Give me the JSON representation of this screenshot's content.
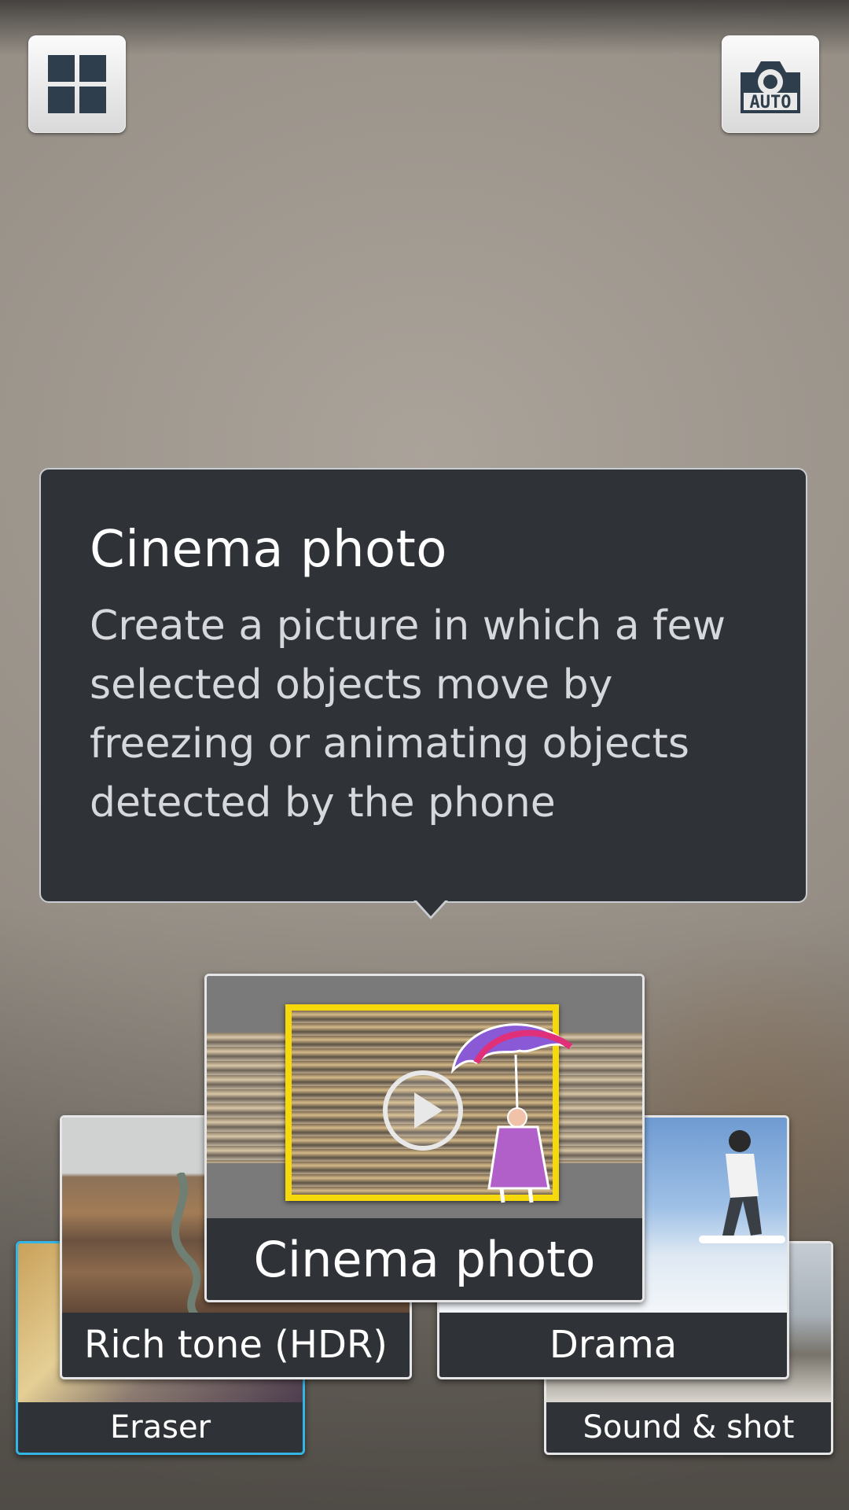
{
  "toolbar": {
    "mode_grid_icon": "grid-icon",
    "auto_mode_icon": "camera-auto-icon",
    "auto_label": "AUTO"
  },
  "tooltip": {
    "title": "Cinema photo",
    "description": "Create a picture in which a few selected objects move by freezing or animating objects detected by the phone"
  },
  "modes": {
    "eraser": "Eraser",
    "rich_tone": "Rich tone (HDR)",
    "cinema_photo": "Cinema photo",
    "drama": "Drama",
    "sound_shot": "Sound & shot"
  },
  "colors": {
    "selected_border": "#33b5e5",
    "highlight_frame": "#f5d90a",
    "panel": "#2f3338"
  }
}
